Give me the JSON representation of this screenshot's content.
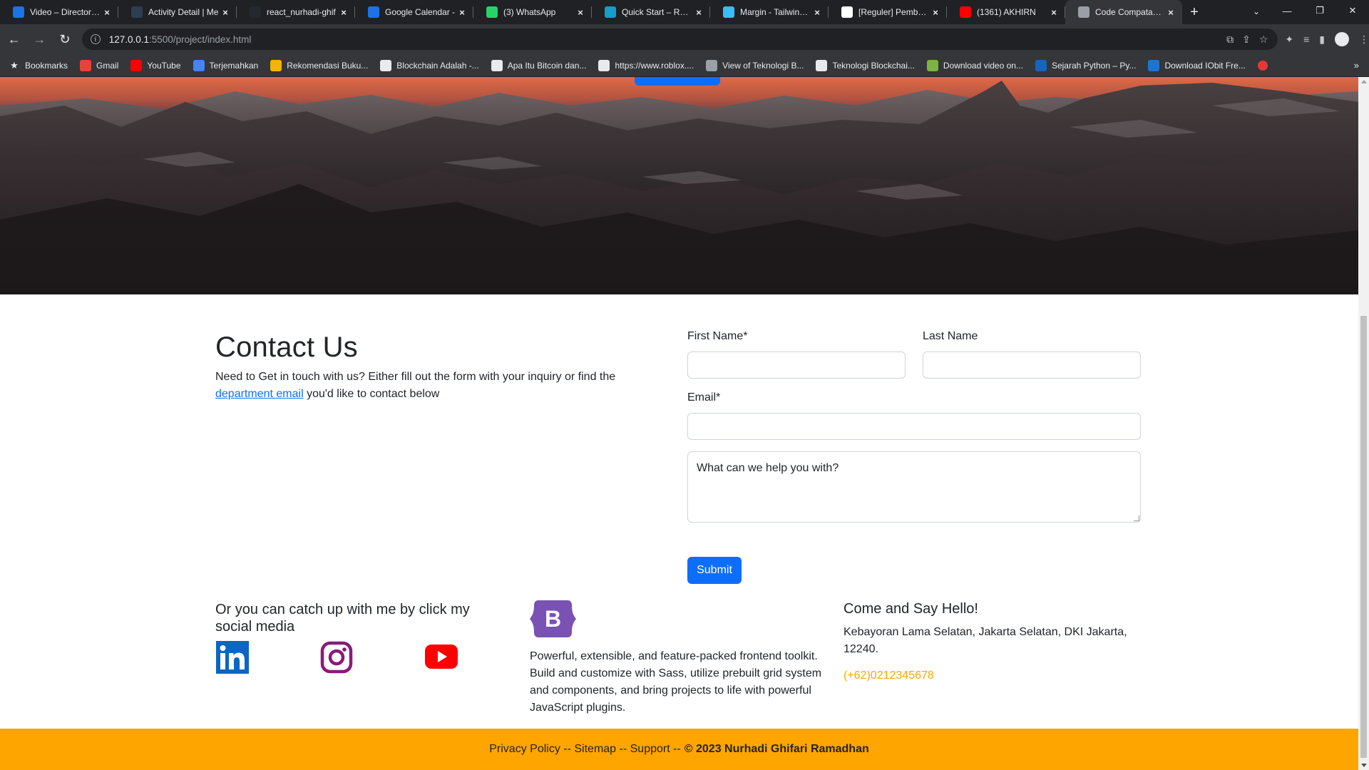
{
  "browser": {
    "tabs": [
      {
        "title": "Video – Directory S",
        "icon": "video-icon",
        "color": "#1a73e8"
      },
      {
        "title": "Activity Detail | Me",
        "icon": "dicoding-icon",
        "color": "#2d3e50"
      },
      {
        "title": "react_nurhadi-ghif",
        "icon": "github-icon",
        "color": "#24292f"
      },
      {
        "title": "Google Calendar -",
        "icon": "calendar-icon",
        "color": "#1a73e8"
      },
      {
        "title": "(3) WhatsApp",
        "icon": "whatsapp-icon",
        "color": "#25d366"
      },
      {
        "title": "Quick Start – React",
        "icon": "react-icon",
        "color": "#149eca"
      },
      {
        "title": "Margin - Tailwind C",
        "icon": "tailwind-icon",
        "color": "#38bdf8"
      },
      {
        "title": "[Reguler] Pembelaj",
        "icon": "notion-icon",
        "color": "#ffffff"
      },
      {
        "title": "(1361) AKHIRN",
        "icon": "youtube-icon",
        "color": "#ff0000"
      },
      {
        "title": "Code Compatance",
        "icon": "globe-icon",
        "color": "#9aa0a6",
        "active": true
      }
    ],
    "url_host": "127.0.0.1",
    "url_path": ":5500/project/index.html",
    "bookmarks": [
      {
        "label": "Bookmarks",
        "icon": "star-icon",
        "color": "#e8eaed"
      },
      {
        "label": "Gmail",
        "icon": "gmail-icon",
        "color": "#ea4335"
      },
      {
        "label": "YouTube",
        "icon": "youtube-icon",
        "color": "#ff0000"
      },
      {
        "label": "Terjemahkan",
        "icon": "translate-icon",
        "color": "#4285f4"
      },
      {
        "label": "Rekomendasi Buku...",
        "icon": "coin-icon",
        "color": "#f4b400"
      },
      {
        "label": "Blockchain Adalah -...",
        "icon": "globe-icon",
        "color": "#e8eaed"
      },
      {
        "label": "Apa Itu Bitcoin dan...",
        "icon": "globe-icon",
        "color": "#e8eaed"
      },
      {
        "label": "https://www.roblox....",
        "icon": "globe-icon",
        "color": "#e8eaed"
      },
      {
        "label": "View of Teknologi B...",
        "icon": "journal-icon",
        "color": "#9aa0a6"
      },
      {
        "label": "Teknologi Blockchai...",
        "icon": "d-icon",
        "color": "#e8eaed"
      },
      {
        "label": "Download video on...",
        "icon": "download-icon",
        "color": "#7cb342"
      },
      {
        "label": "Sejarah Python – Py...",
        "icon": "python-icon",
        "color": "#1565c0"
      },
      {
        "label": "Download IObit Fre...",
        "icon": "iobit-icon",
        "color": "#1976d2"
      }
    ]
  },
  "contact": {
    "title": "Contact Us",
    "text_before": "Need to Get in touch with us? Either fill out the form with your inquiry or find the ",
    "link": "department email",
    "text_after": " you'd like to contact below"
  },
  "form": {
    "first_name_label": "First Name*",
    "last_name_label": "Last Name",
    "email_label": "Email*",
    "message_placeholder": "What can we help you with?",
    "submit_label": "Submit"
  },
  "social": {
    "title": "Or you can catch up with me by click my social media",
    "icons": [
      "linkedin-icon",
      "instagram-icon",
      "youtube-icon"
    ]
  },
  "bootstrap": {
    "logo_letter": "B",
    "description": "Powerful, extensible, and feature-packed frontend toolkit. Build and customize with Sass, utilize prebuilt grid system and components, and bring projects to life with powerful JavaScript plugins."
  },
  "hello": {
    "title": "Come and Say Hello!",
    "address": "Kebayoran Lama Selatan, Jakarta Selatan, DKI Jakarta, 12240.",
    "phone": "(+62)0212345678"
  },
  "footer": {
    "links": "Privacy Policy -- Sitemap -- Support --",
    "copyright": "© 2023 Nurhadi Ghifari Ramadhan"
  },
  "colors": {
    "primary": "#0d6efd",
    "footer_bg": "#ffa500",
    "phone": "#ffa500",
    "bootstrap_purple": "#7952b3"
  }
}
